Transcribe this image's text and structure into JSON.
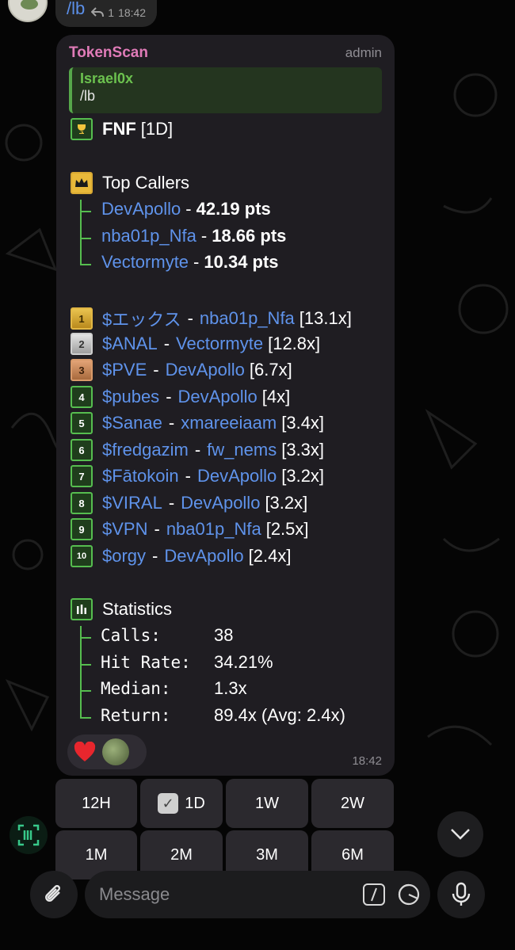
{
  "previous_message": {
    "text": "/lb",
    "reply_count": "1",
    "time": "18:42"
  },
  "bubble": {
    "sender": "TokenScan",
    "role": "admin",
    "reply_to": {
      "name": "Israel0x",
      "text": "/lb"
    },
    "header": {
      "title": "FNF",
      "period": "[1D]"
    },
    "top_callers_title": "Top Callers",
    "top_callers": [
      {
        "name": "DevApollo",
        "score": "42.19 pts"
      },
      {
        "name": "nba01p_Nfa",
        "score": "18.66 pts"
      },
      {
        "name": "Vectormyte",
        "score": "10.34 pts"
      }
    ],
    "leaderboard": [
      {
        "rank": "1",
        "token": "$エックス",
        "caller": "nba01p_Nfa",
        "mult": "[13.1x]"
      },
      {
        "rank": "2",
        "token": "$ANAL",
        "caller": "Vectormyte",
        "mult": "[12.8x]"
      },
      {
        "rank": "3",
        "token": "$PVE",
        "caller": "DevApollo",
        "mult": "[6.7x]"
      },
      {
        "rank": "4",
        "token": "$pubes",
        "caller": "DevApollo",
        "mult": "[4x]"
      },
      {
        "rank": "5",
        "token": "$Sanae",
        "caller": "xmareeiaam",
        "mult": "[3.4x]"
      },
      {
        "rank": "6",
        "token": "$fredgazim",
        "caller": "fw_nems",
        "mult": "[3.3x]"
      },
      {
        "rank": "7",
        "token": "$Fātokoin",
        "caller": "DevApollo",
        "mult": "[3.2x]"
      },
      {
        "rank": "8",
        "token": "$VIRAL",
        "caller": "DevApollo",
        "mult": "[3.2x]"
      },
      {
        "rank": "9",
        "token": "$VPN",
        "caller": "nba01p_Nfa",
        "mult": "[2.5x]"
      },
      {
        "rank": "10",
        "token": "$orgy",
        "caller": "DevApollo",
        "mult": "[2.4x]"
      }
    ],
    "separator": "-",
    "statistics_title": "Statistics",
    "statistics": [
      {
        "label": "Calls:",
        "value": "38"
      },
      {
        "label": "Hit Rate:",
        "value": "34.21%"
      },
      {
        "label": "Median:",
        "value": "1.3x"
      },
      {
        "label": "Return:",
        "value": "89.4x (Avg: 2.4x)"
      }
    ],
    "time": "18:42"
  },
  "keyboard": [
    {
      "label": "12H",
      "selected": false
    },
    {
      "label": "1D",
      "selected": true
    },
    {
      "label": "1W",
      "selected": false
    },
    {
      "label": "2W",
      "selected": false
    },
    {
      "label": "1M",
      "selected": false
    },
    {
      "label": "2M",
      "selected": false
    },
    {
      "label": "3M",
      "selected": false
    },
    {
      "label": "6M",
      "selected": false
    }
  ],
  "composer": {
    "placeholder": "Message"
  },
  "colors": {
    "accent_green": "#56bd4f",
    "link_blue": "#5f93eb",
    "sender_pink": "#e07bb8"
  }
}
